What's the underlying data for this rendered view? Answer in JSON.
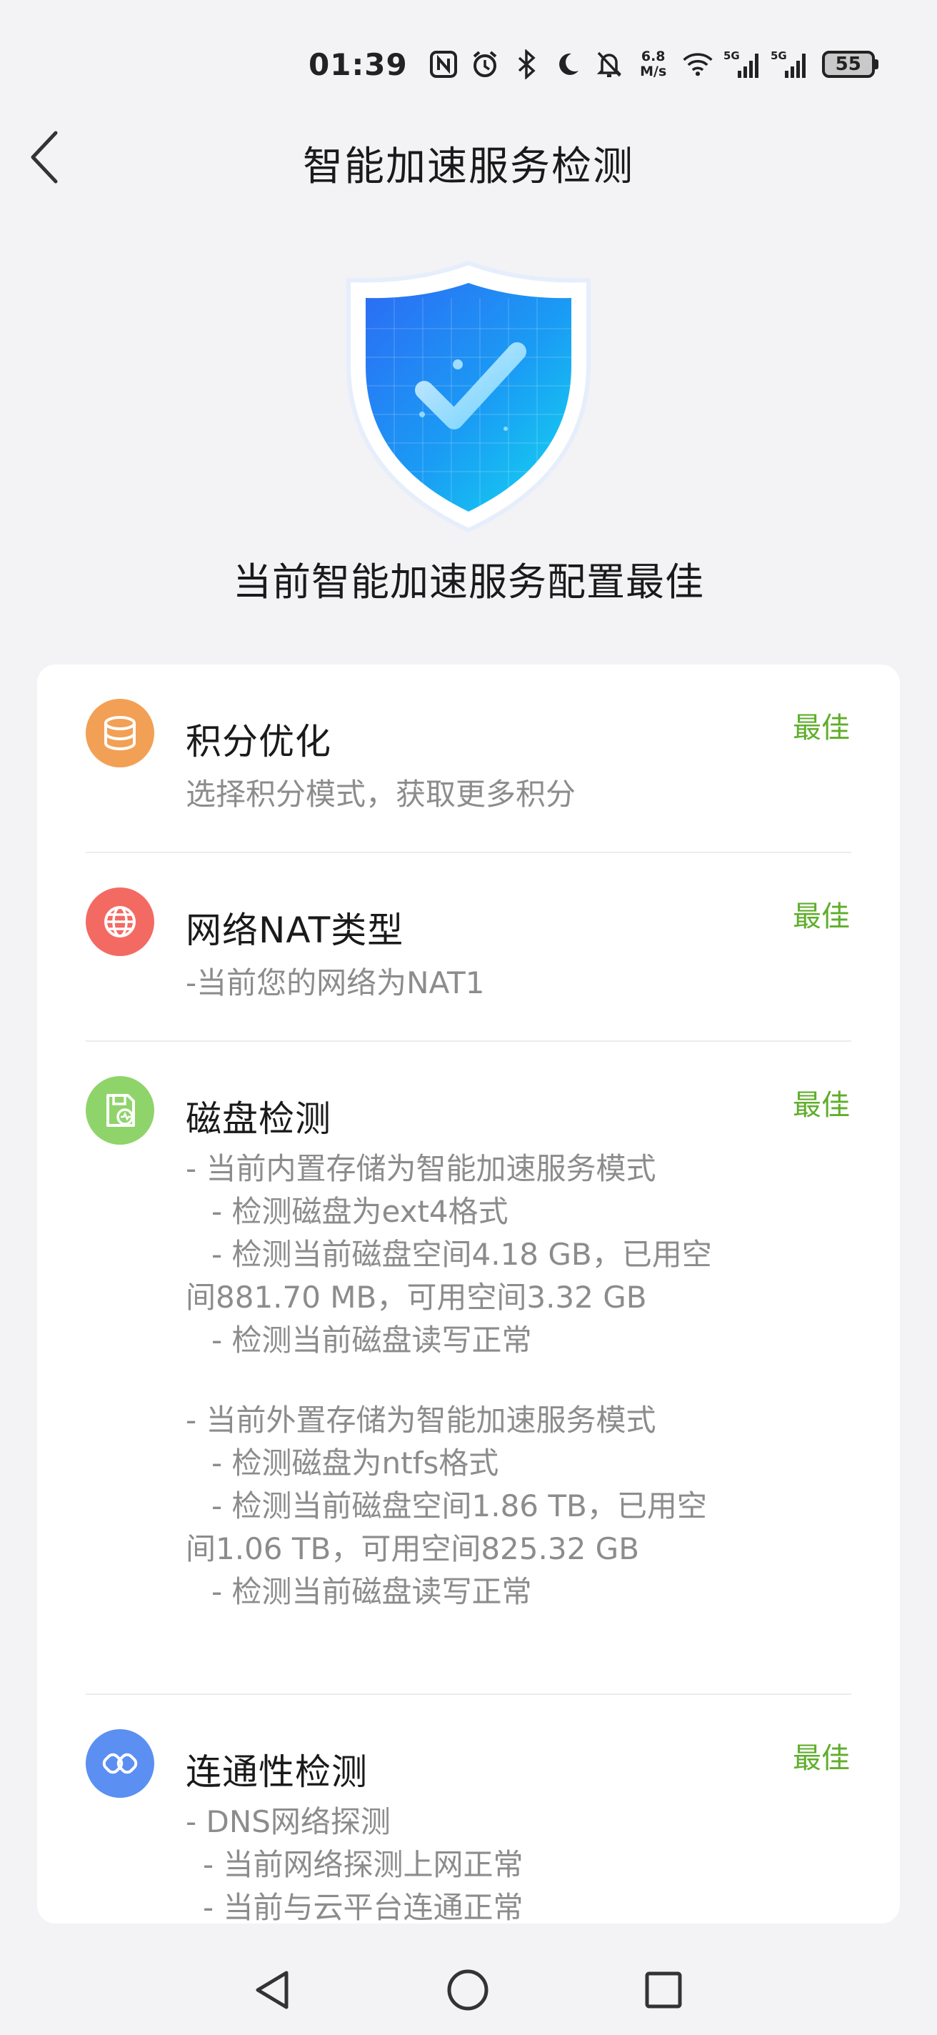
{
  "status_bar": {
    "time": "01:39",
    "speed_value": "6.8",
    "speed_unit": "M/s",
    "battery": "55",
    "signal_label_1": "5G",
    "signal_label_2": "5G"
  },
  "header": {
    "title": "智能加速服务检测"
  },
  "hero": {
    "status_text": "当前智能加速服务配置最佳"
  },
  "colors": {
    "status_green": "#5fae2a",
    "points_icon": "#f2a055",
    "nat_icon": "#f36a63",
    "disk_icon": "#8fd46a",
    "connectivity_icon": "#5b8ff2"
  },
  "items": [
    {
      "title": "积分优化",
      "status": "最佳",
      "icon": "database-icon",
      "desc": [
        "选择积分模式，获取更多积分"
      ]
    },
    {
      "title": "网络NAT类型",
      "status": "最佳",
      "icon": "globe-icon",
      "desc": [
        "-当前您的网络为NAT1"
      ]
    },
    {
      "title": "磁盘检测",
      "status": "最佳",
      "icon": "disk-check-icon",
      "desc": [
        "- 当前内置存储为智能加速服务模式",
        "- 检测磁盘为ext4格式",
        "- 检测当前磁盘空间4.18 GB，已用空",
        "间881.70 MB，可用空间3.32 GB",
        "- 检测当前磁盘读写正常",
        "- 当前外置存储为智能加速服务模式",
        "- 检测磁盘为ntfs格式",
        "- 检测当前磁盘空间1.86 TB，已用空",
        "间1.06 TB，可用空间825.32 GB",
        "- 检测当前磁盘读写正常"
      ]
    },
    {
      "title": "连通性检测",
      "status": "最佳",
      "icon": "connectivity-icon",
      "desc": [
        "- DNS网络探测",
        "- 当前网络探测上网正常",
        "- 当前与云平台连通正常"
      ]
    }
  ],
  "navbar": {
    "back": "nav-back-icon",
    "home": "nav-home-icon",
    "recents": "nav-recents-icon"
  }
}
